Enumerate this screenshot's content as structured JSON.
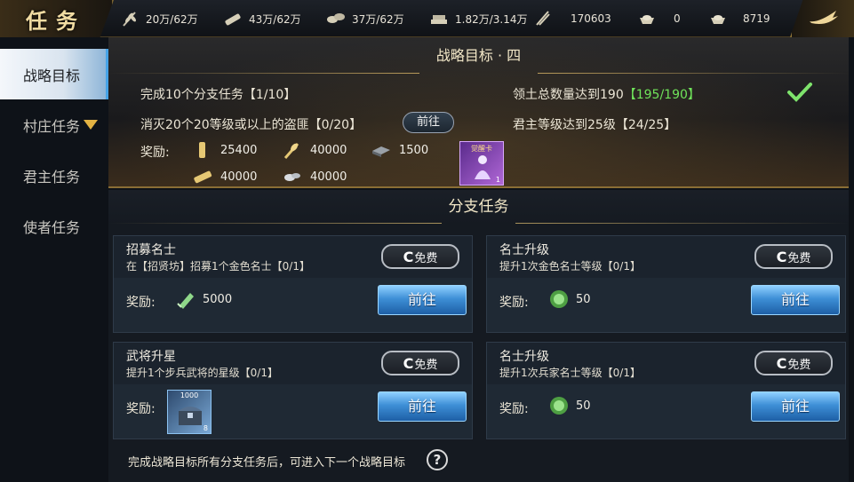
{
  "header": {
    "title": "任务",
    "resources": [
      {
        "icon": "grain-icon",
        "value": "20万/62万"
      },
      {
        "icon": "wood-icon",
        "value": "43万/62万"
      },
      {
        "icon": "stone-icon",
        "value": "37万/62万"
      },
      {
        "icon": "iron-icon",
        "value": "1.82万/3.14万"
      },
      {
        "icon": "troops-icon",
        "value": "170603"
      },
      {
        "icon": "gold-ingot-icon",
        "value": "0"
      },
      {
        "icon": "silver-ingot-icon",
        "value": "8719"
      }
    ],
    "back_icon": "back-arrow-icon"
  },
  "sidebar": {
    "items": [
      {
        "label": "战略目标",
        "active": true
      },
      {
        "label": "村庄任务",
        "active": false,
        "has_dropdown": true
      },
      {
        "label": "君主任务",
        "active": false
      },
      {
        "label": "使者任务",
        "active": false
      }
    ]
  },
  "goal": {
    "title": "战略目标 · 四",
    "tasks": [
      {
        "text": "完成10个分支任务【1/10】"
      },
      {
        "text": "消灭20个20等级或以上的盗匪【0/20】",
        "button": "前往"
      },
      {
        "text": "领土总数量达到190",
        "progress": "【195/190】",
        "done": true
      },
      {
        "text": "君主等级达到25级【24/25】"
      }
    ],
    "reward_label": "奖励:",
    "rewards": [
      {
        "icon": "wood-icon",
        "value": "25400"
      },
      {
        "icon": "grain-icon",
        "value": "40000"
      },
      {
        "icon": "iron-icon",
        "value": "1500"
      },
      {
        "icon": "wood-icon",
        "value": "40000"
      },
      {
        "icon": "stone-icon",
        "value": "40000"
      }
    ],
    "card": {
      "label": "觉醒卡",
      "count": "1"
    }
  },
  "branch": {
    "title": "分支任务",
    "tasks": [
      {
        "name": "招募名士",
        "desc": "在【招贤坊】招募1个金色名士【0/1】",
        "free": "免费",
        "reward_label": "奖励:",
        "reward_icon": "troops-token-icon",
        "reward_value": "5000",
        "go": "前往"
      },
      {
        "name": "名士升级",
        "desc": "提升1次金色名士等级【0/1】",
        "free": "免费",
        "reward_label": "奖励:",
        "reward_icon": "jade-icon",
        "reward_value": "50",
        "go": "前往"
      },
      {
        "name": "武将升星",
        "desc": "提升1个步兵武将的星级【0/1】",
        "free": "免费",
        "reward_label": "奖励:",
        "reward_icon": "treasure-box-icon",
        "reward_value": "",
        "box_label": "1000",
        "box_count": "8",
        "go": "前往"
      },
      {
        "name": "名士升级",
        "desc": "提升1次兵家名士等级【0/1】",
        "free": "免费",
        "reward_label": "奖励:",
        "reward_icon": "jade-icon",
        "reward_value": "50",
        "go": "前往"
      }
    ]
  },
  "footer": {
    "tip": "完成战略目标所有分支任务后，可进入下一个战略目标",
    "help": "?"
  },
  "colors": {
    "accent_gold": "#b89a5a",
    "complete_green": "#6fe35a",
    "button_blue": "#3e8fd6"
  }
}
